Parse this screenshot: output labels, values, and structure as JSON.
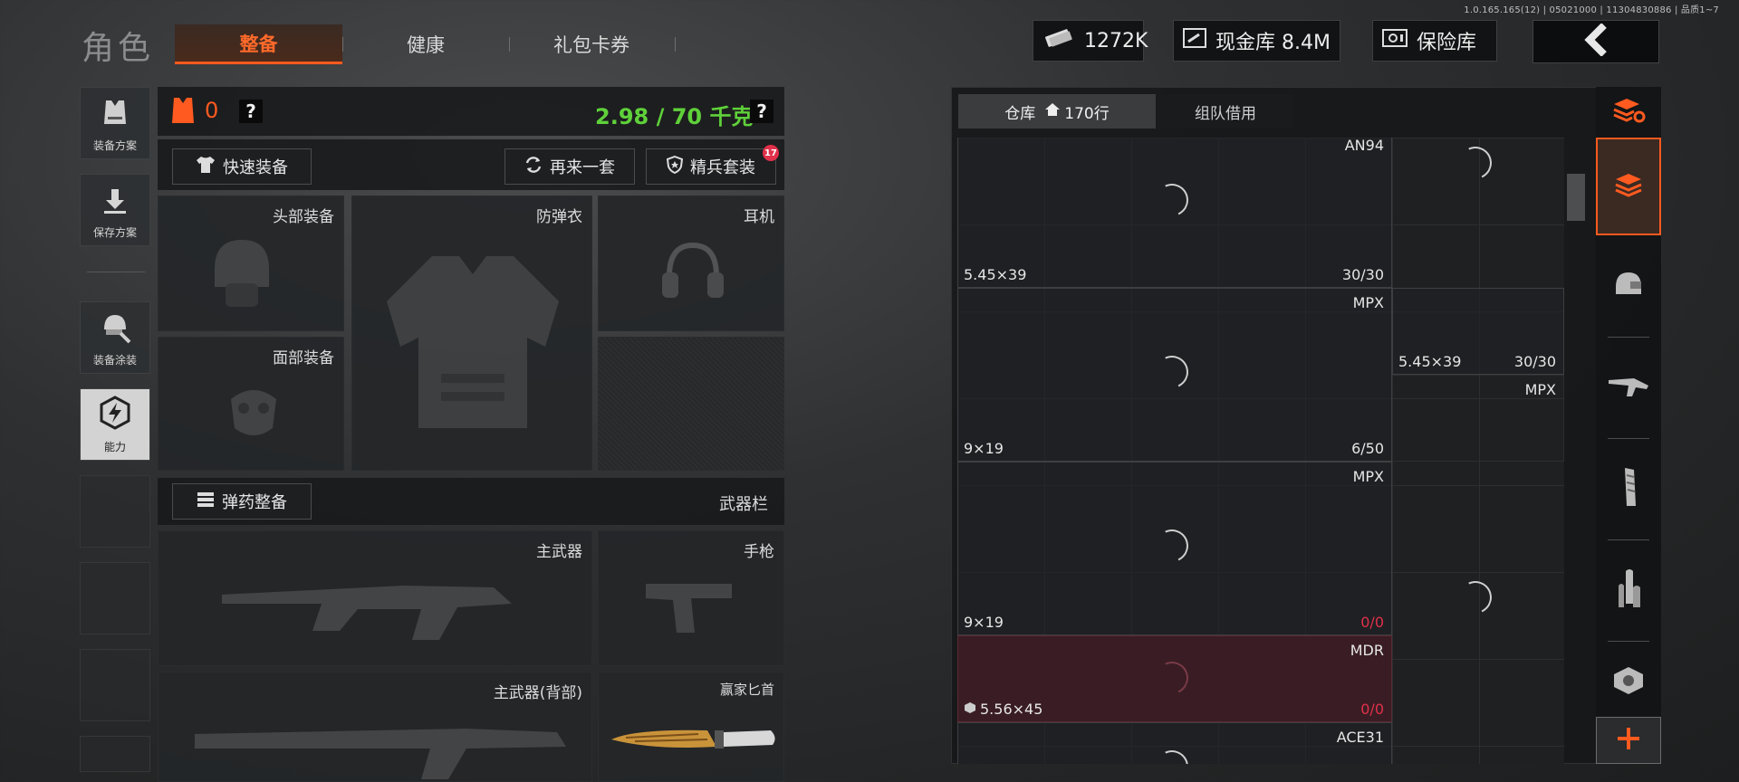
{
  "version": "1.0.165.165(12) | 05021000 | 11304830886 | 品质1~7",
  "title": "角色",
  "tabs": [
    {
      "label": "整备",
      "active": true
    },
    {
      "label": "健康",
      "active": false
    },
    {
      "label": "礼包卡券",
      "active": false
    }
  ],
  "currency": {
    "cash": "1272K",
    "cash_vault": "现金库 8.4M",
    "safe": "保险库"
  },
  "left_rail": [
    {
      "label": "装备方案",
      "icon": "vest-icon"
    },
    {
      "label": "保存方案",
      "icon": "download-icon"
    },
    {
      "label": "装备涂装",
      "icon": "helmet-paint-icon"
    },
    {
      "label": "能力",
      "icon": "lightning-hexagon-icon",
      "active": true
    }
  ],
  "loadout": {
    "armor_count": "0",
    "help": "?",
    "weight": "2.98 / 70 千克",
    "quick_equip": "快速装备",
    "redo": "再来一套",
    "elite": "精兵套装",
    "elite_badge": "17",
    "slots": {
      "head": "头部装备",
      "vest": "防弹衣",
      "headset": "耳机",
      "face": "面部装备",
      "primary": "主武器",
      "pistol": "手枪",
      "primary_back": "主武器(背部)",
      "melee": "赢家匕首"
    },
    "ammo_btn": "弹药整备",
    "weapon_bar": "武器栏"
  },
  "warehouse": {
    "tab_warehouse": "仓库",
    "rows": "170行",
    "tab_team": "组队借用",
    "items": [
      {
        "name": "AN94",
        "caliber": "5.45×39",
        "amount": "30/30"
      },
      {
        "name": "MPX",
        "caliber": "9×19",
        "amount": "6/50"
      },
      {
        "name": "MPX",
        "caliber": "9×19",
        "amount_cur": "0",
        "amount_max": "/0"
      },
      {
        "name": "MDR",
        "caliber": "5.56×45",
        "amount_cur": "0",
        "amount_max": "/0"
      },
      {
        "name": "ACE31",
        "caliber": "",
        "amount": ""
      },
      {
        "name": "MPX",
        "caliber": "5.45×39",
        "amount": "30/30"
      }
    ]
  },
  "colors": {
    "accent": "#ff5a1f",
    "weight_green": "#5fd13a",
    "alert_red": "#e0304a"
  }
}
